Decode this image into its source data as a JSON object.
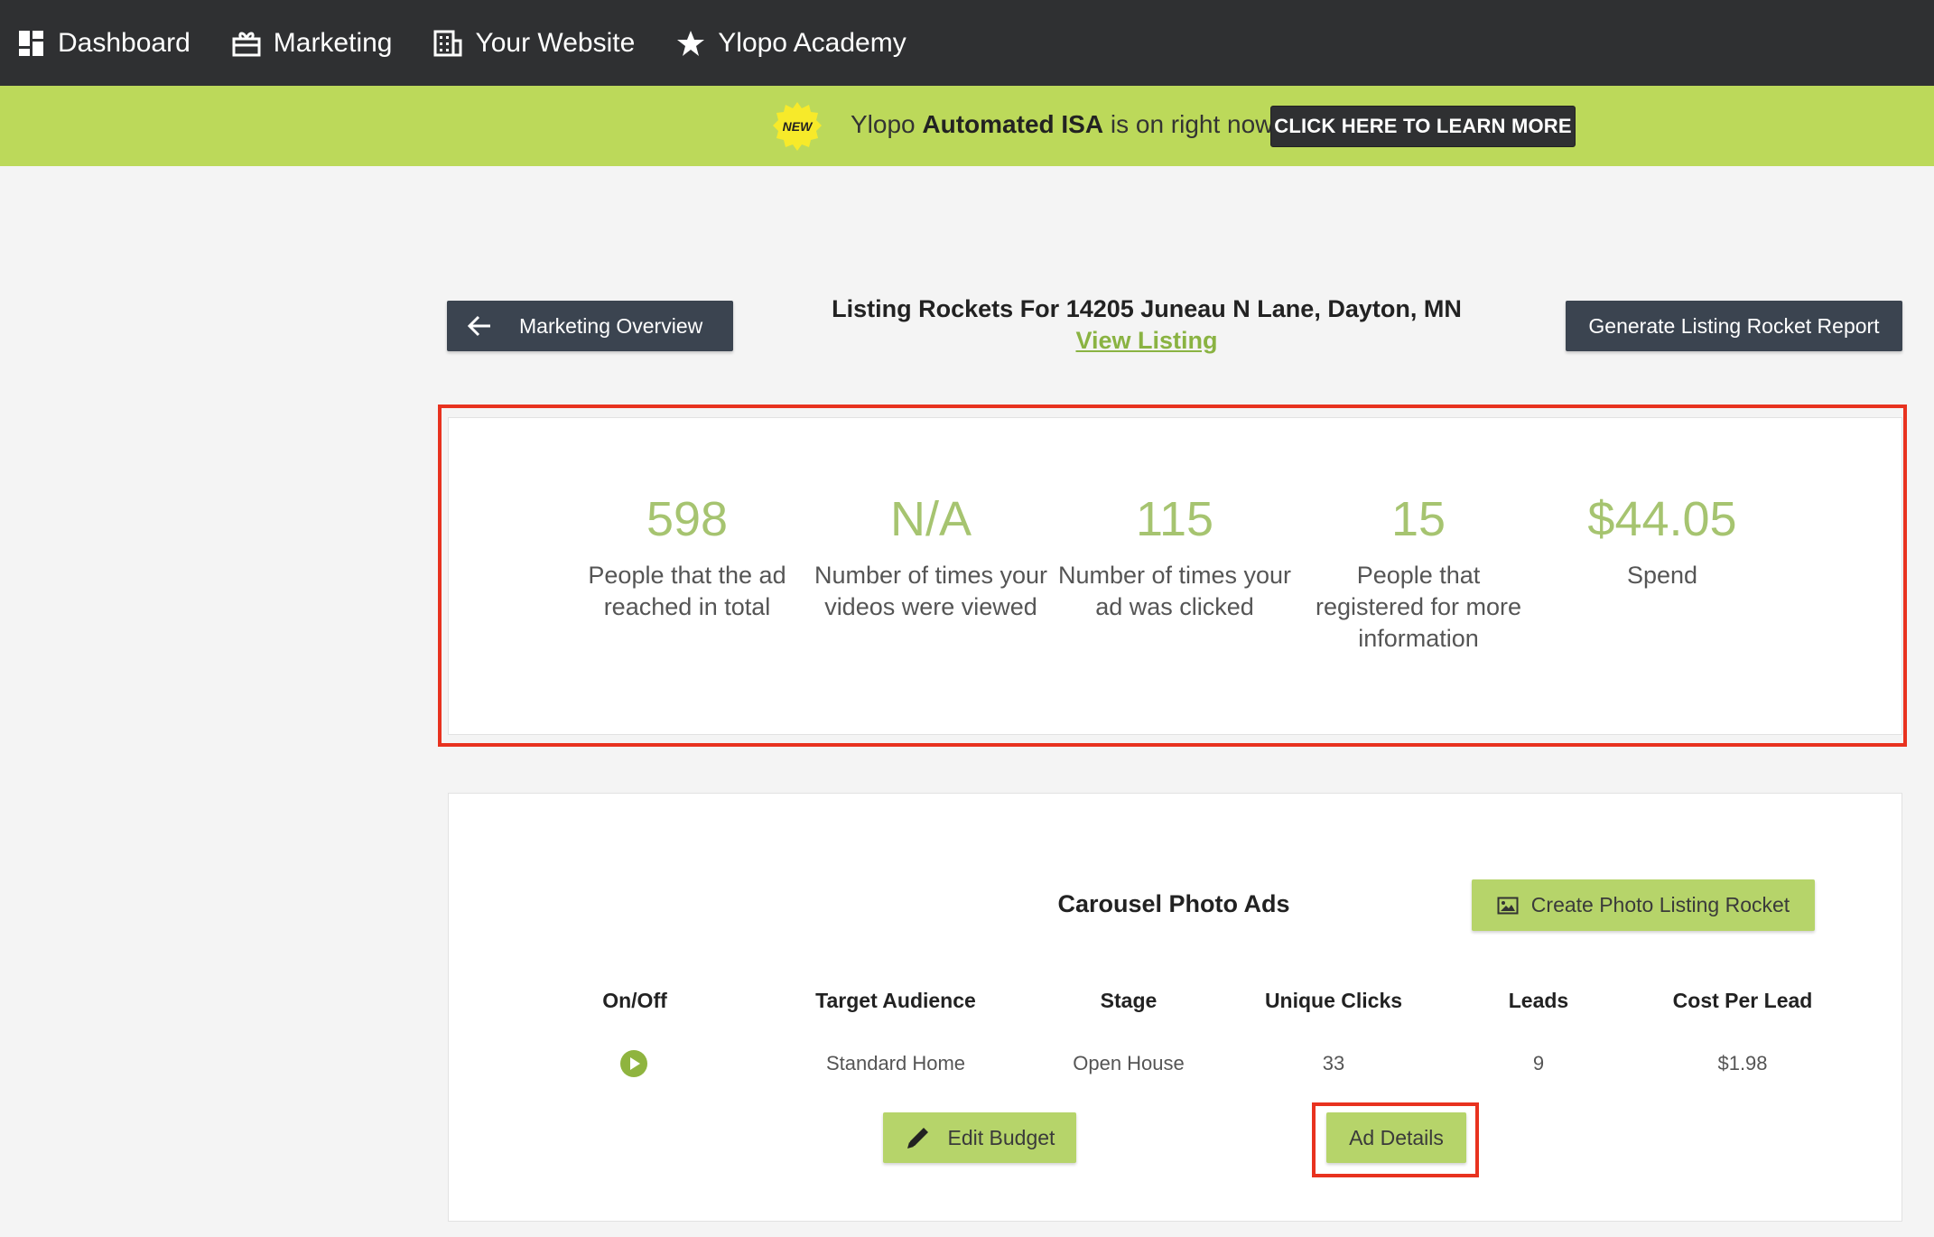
{
  "nav": {
    "items": [
      {
        "label": "Dashboard",
        "icon": "dashboard-icon"
      },
      {
        "label": "Marketing",
        "icon": "gift-icon"
      },
      {
        "label": "Your Website",
        "icon": "building-icon"
      },
      {
        "label": "Ylopo Academy",
        "icon": "star-icon"
      }
    ]
  },
  "promo": {
    "badge": "NEW",
    "text_prefix": "Ylopo ",
    "text_bold": "Automated ISA",
    "text_suffix": " is on right now",
    "button_label": "CLICK HERE TO LEARN MORE"
  },
  "header": {
    "back_label": "Marketing Overview",
    "title": "Listing Rockets For 14205 Juneau N Lane, Dayton, MN",
    "view_listing": "View Listing",
    "report_label": "Generate Listing Rocket Report"
  },
  "stats": [
    {
      "value": "598",
      "label": "People that the ad reached in total"
    },
    {
      "value": "N/A",
      "label": "Number of times your videos were viewed"
    },
    {
      "value": "115",
      "label": "Number of times your ad was clicked"
    },
    {
      "value": "15",
      "label": "People that registered for more information"
    },
    {
      "value": "$44.05",
      "label": "Spend"
    }
  ],
  "carousel": {
    "title": "Carousel Photo Ads",
    "create_label": "Create Photo Listing Rocket",
    "columns": [
      "On/Off",
      "Target Audience",
      "Stage",
      "Unique Clicks",
      "Leads",
      "Cost Per Lead"
    ],
    "row": {
      "audience": "Standard Home",
      "stage": "Open House",
      "clicks": "33",
      "leads": "9",
      "cost_per_lead": "$1.98"
    },
    "edit_label": "Edit Budget",
    "details_label": "Ad Details"
  },
  "colors": {
    "nav_bg": "#2f3032",
    "promo_bg": "#bcd95a",
    "accent_green": "#b6d46a",
    "stat_green": "#a6c470",
    "highlight_red": "#e8321f"
  }
}
